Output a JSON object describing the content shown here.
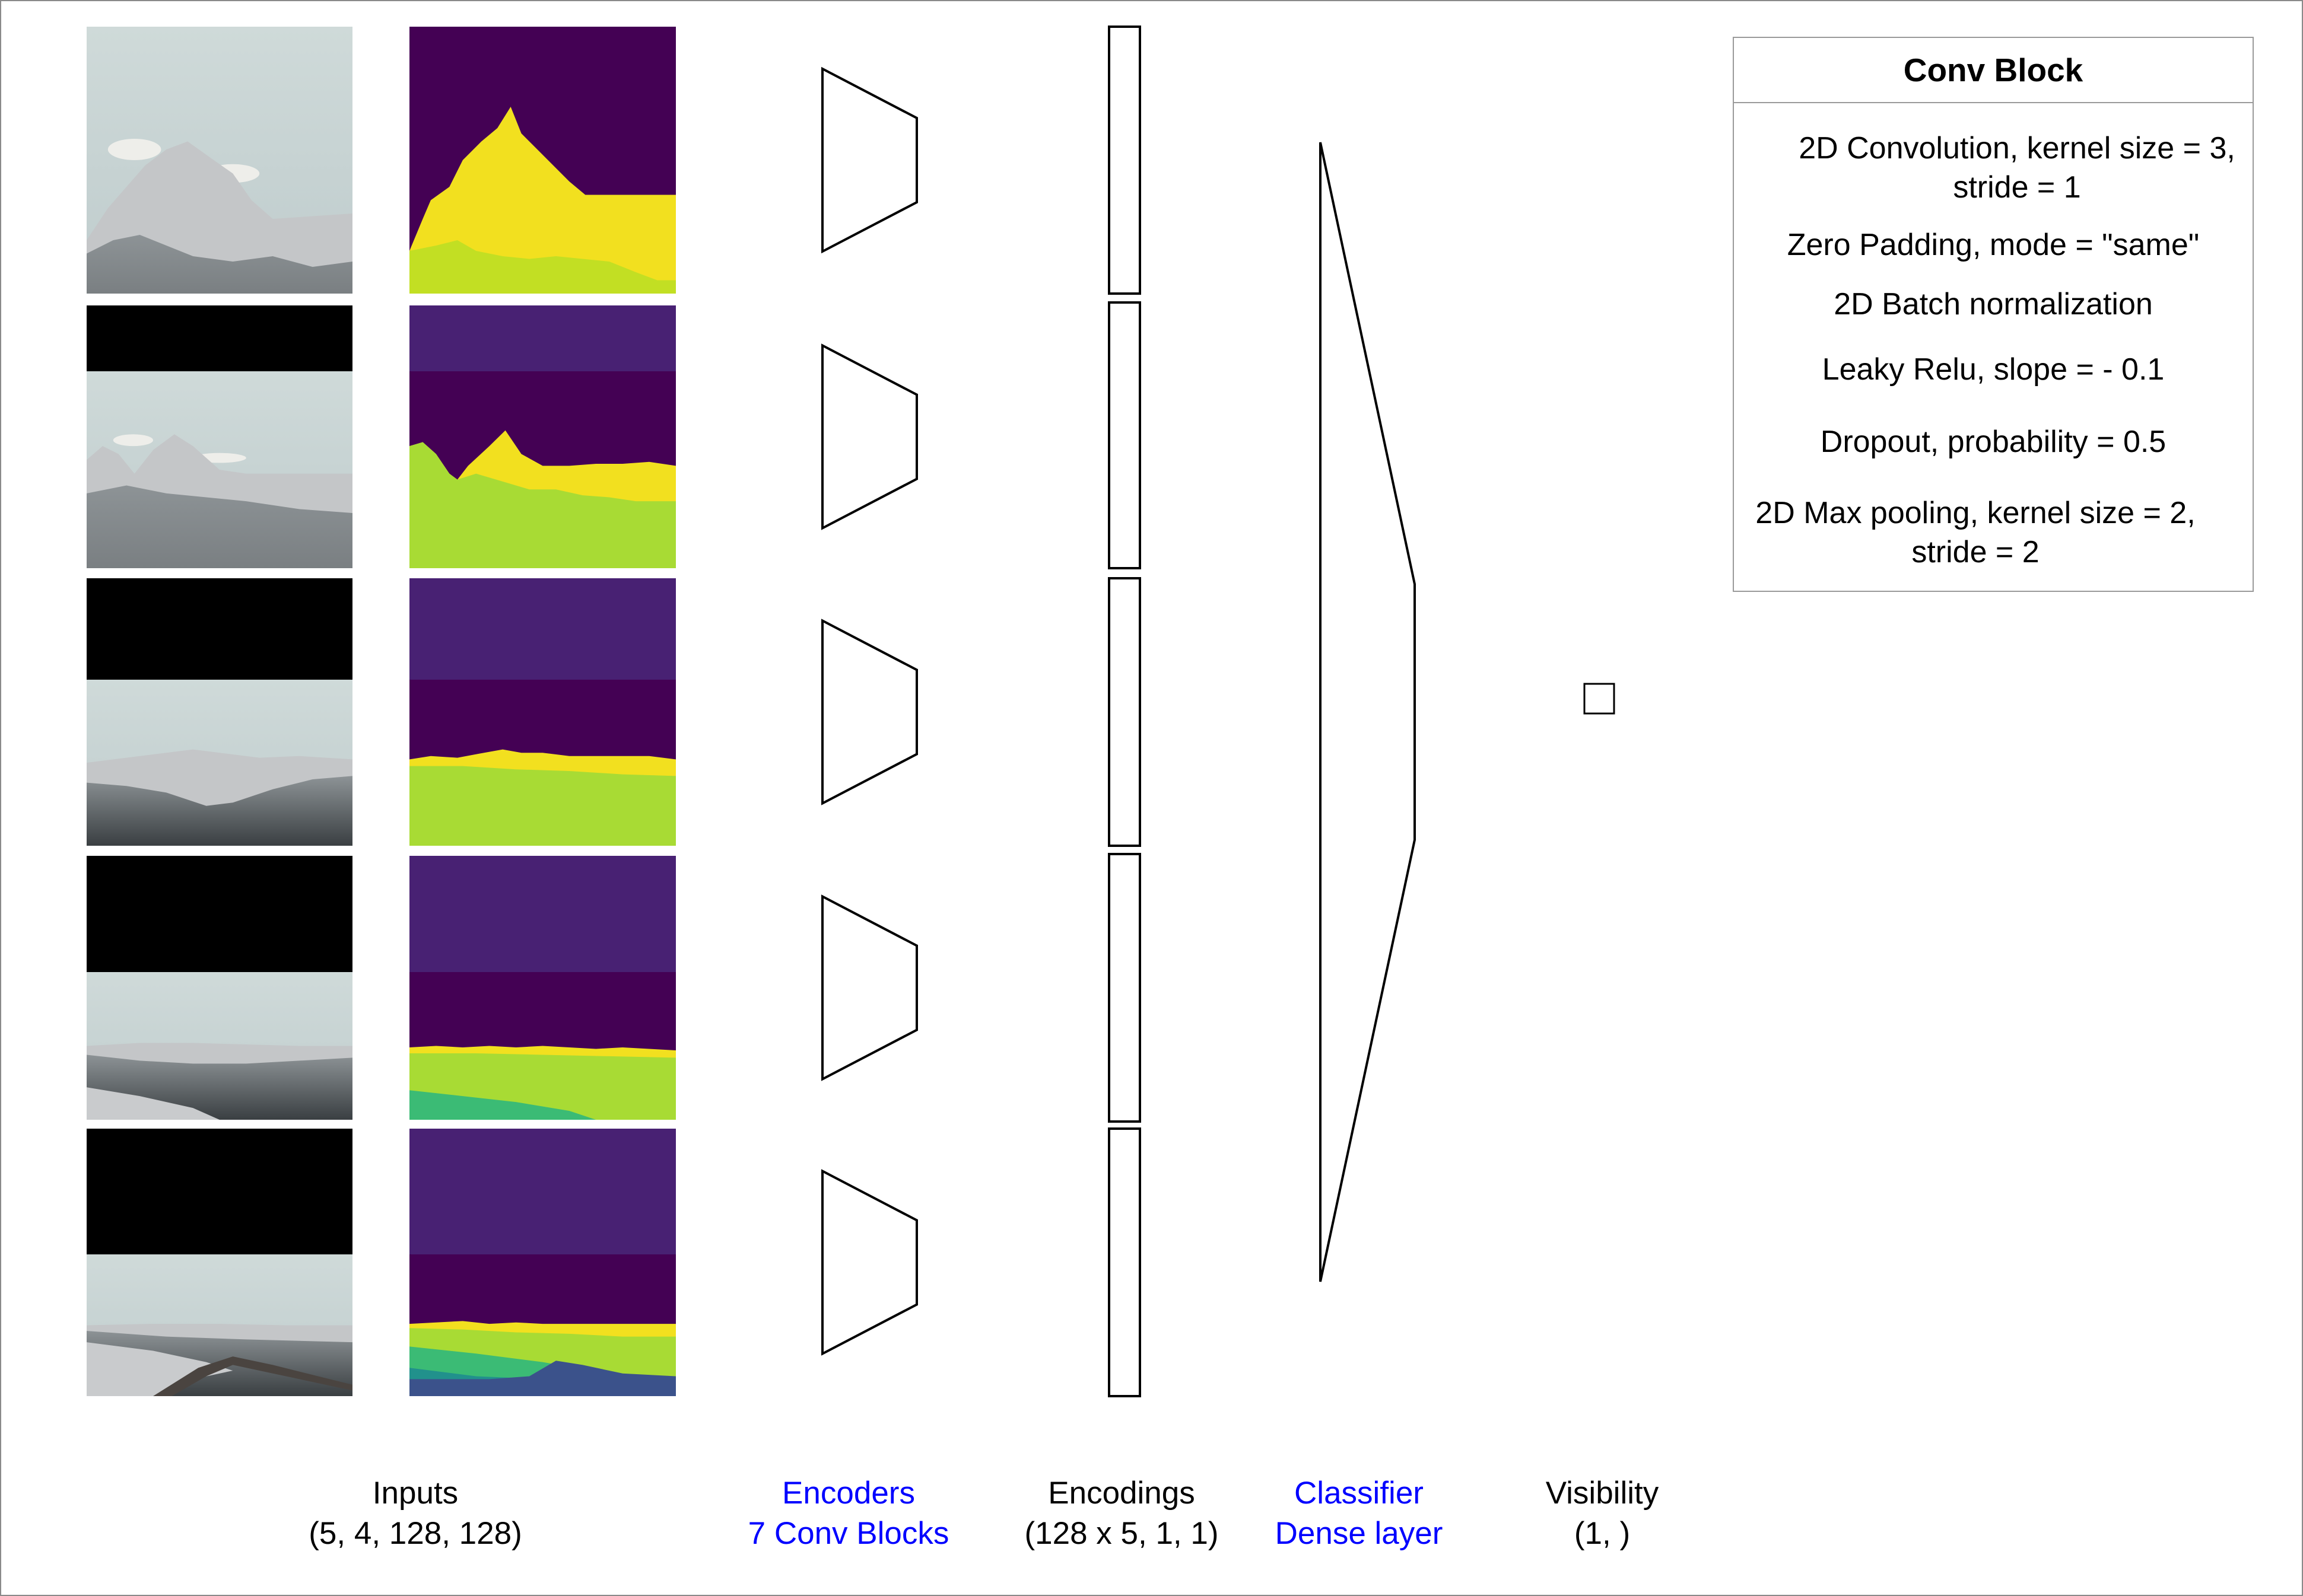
{
  "conv_block": {
    "title": "Conv Block",
    "items": [
      "2D Convolution, kernel size = 3, stride = 1",
      "Zero Padding, mode = \"same\"",
      "2D Batch normalization",
      "Leaky Relu, slope = - 0.1",
      "Dropout, probability = 0.5",
      "2D Max pooling, kernel size = 2, stride = 2"
    ],
    "items_lines": [
      [
        "2D Convolution, kernel size = 3,",
        "stride = 1"
      ],
      [
        "Zero Padding, mode = \"same\""
      ],
      [
        "2D Batch normalization"
      ],
      [
        "Leaky Relu, slope = - 0.1"
      ],
      [
        "Dropout, probability = 0.5"
      ],
      [
        "2D Max pooling, kernel size = 2,",
        "stride = 2"
      ]
    ]
  },
  "stages": [
    {
      "name": "Inputs",
      "shape": "(5, 4, 128, 128)",
      "color": "#000000"
    },
    {
      "name": "Encoders",
      "shape": "7 Conv Blocks",
      "color": "#0000ff"
    },
    {
      "name": "Encodings",
      "shape": "(128 x 5, 1, 1)",
      "color": "#000000"
    },
    {
      "name": "Classifier",
      "shape": "Dense layer",
      "color": "#0000ff"
    },
    {
      "name": "Visibility",
      "shape": "(1, )",
      "color": "#000000"
    }
  ],
  "inputs": {
    "count": 5,
    "masked_top_fraction": [
      0,
      0.25,
      0.38,
      0.44,
      0.47
    ],
    "segmentation_colors": {
      "sky": "#440154",
      "mask": "#482173",
      "peak": "#f2e01f",
      "ridge": "#c2df23",
      "slope": "#a8db34",
      "meadow": "#3bbb75",
      "valley": "#21918c",
      "foreground": "#3b528b"
    },
    "photo_colors": {
      "sky": "#c9d6d6",
      "snow": "#c4c6c8",
      "rock": "#5c6264",
      "dark": "#3a3f42",
      "mask": "#000000"
    }
  },
  "accent_color": "#0000ff"
}
